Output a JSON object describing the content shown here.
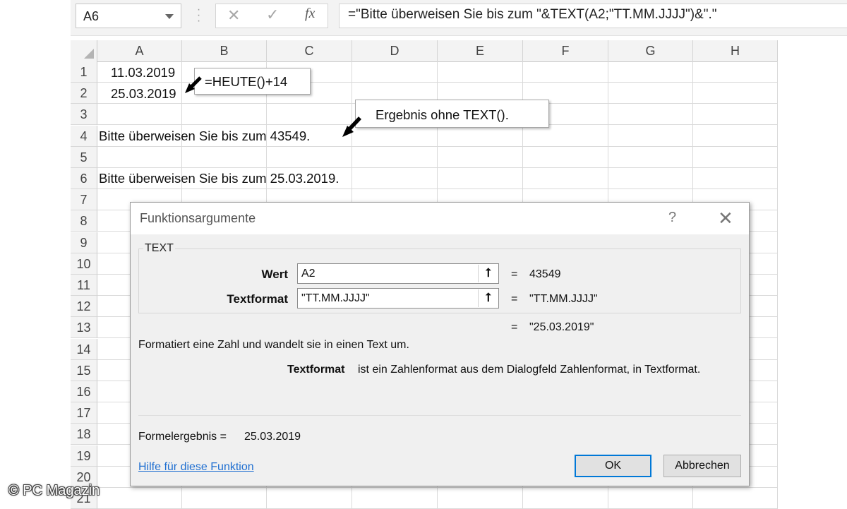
{
  "formula_bar": {
    "name_box": "A6",
    "fx_label": "fx",
    "formula": "=\"Bitte überweisen Sie bis zum \"&TEXT(A2;\"TT.MM.JJJJ\")&\".\""
  },
  "columns": [
    "A",
    "B",
    "C",
    "D",
    "E",
    "F",
    "G",
    "H"
  ],
  "rows": [
    "1",
    "2",
    "3",
    "4",
    "5",
    "6",
    "7",
    "8",
    "9",
    "10",
    "11",
    "12",
    "13",
    "14",
    "15",
    "16",
    "17",
    "18",
    "19",
    "20",
    "21"
  ],
  "cells": {
    "a1": "11.03.2019",
    "a2": "25.03.2019",
    "a4": "Bitte überweisen Sie bis zum 43549.",
    "a6": "Bitte überweisen Sie bis zum 25.03.2019."
  },
  "callouts": {
    "heute": "=HEUTE()+14",
    "ohne_text": "Ergebnis ohne TEXT()."
  },
  "dialog": {
    "title": "Funktionsargumente",
    "help_glyph": "?",
    "close_glyph": "✕",
    "function_name": "TEXT",
    "args": [
      {
        "label": "Wert",
        "value": "A2",
        "result": "43549"
      },
      {
        "label": "Textformat",
        "value": "\"TT.MM.JJJJ\"",
        "result": "\"TT.MM.JJJJ\""
      }
    ],
    "equals": "=",
    "overall_result": "\"25.03.2019\"",
    "description": "Formatiert eine Zahl und wandelt sie in einen Text um.",
    "arg_help_name": "Textformat",
    "arg_help_text": "ist ein Zahlenformat aus dem Dialogfeld Zahlenformat, in Textformat.",
    "formula_result_label": "Formelergebnis =",
    "formula_result_value": "25.03.2019",
    "help_link": "Hilfe für diese Funktion",
    "ok_label": "OK",
    "cancel_label": "Abbrechen"
  },
  "copyright": "© PC Magazin",
  "colors": {
    "accent": "#0078d7",
    "link": "#1f6fd1",
    "header_bg": "#f3f3f3",
    "dialog_bg": "#f0f0f0"
  },
  "icons": {
    "namebox_dropdown": "chevron-down-icon",
    "cancel_formula": "close-icon",
    "enter_formula": "check-icon",
    "insert_function": "fx-icon",
    "ref_button": "collapse-arrow-up-icon",
    "callout_pointer": "arrow-icon"
  }
}
